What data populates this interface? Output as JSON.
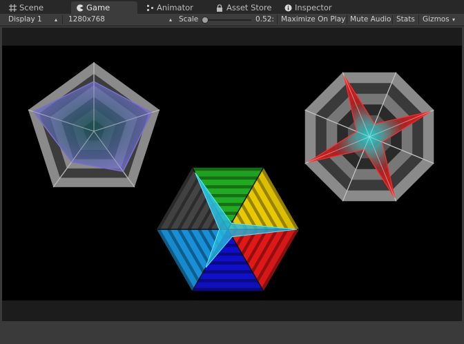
{
  "tabs": [
    {
      "label": "Scene",
      "icon": "grid-icon",
      "active": false
    },
    {
      "label": "Game",
      "icon": "pacman-icon",
      "active": true
    },
    {
      "label": "Animator",
      "icon": "animator-icon",
      "active": false
    },
    {
      "label": "Asset Store",
      "icon": "lock-icon",
      "active": false
    },
    {
      "label": "Inspector",
      "icon": "info-icon",
      "active": false
    }
  ],
  "toolbar": {
    "display": "Display 1",
    "resolution": "1280x768",
    "scale_label": "Scale",
    "scale_value": "0.52:",
    "maximize_on_play": "Maximize On Play",
    "mute_audio": "Mute Audio",
    "stats": "Stats",
    "gizmos": "Gizmos"
  },
  "colors": {
    "stage_background": "#000000",
    "pentagon_fill": "#7a6fd0",
    "octagon_fill": "#e01818",
    "octagon_center": "#20d8d8",
    "hexagon_data_fill": "#28c8e8",
    "hexagon_bands": [
      "#22aa22",
      "#e8c800",
      "#e01818",
      "#1010c8",
      "#1890d8",
      "#444444"
    ]
  }
}
